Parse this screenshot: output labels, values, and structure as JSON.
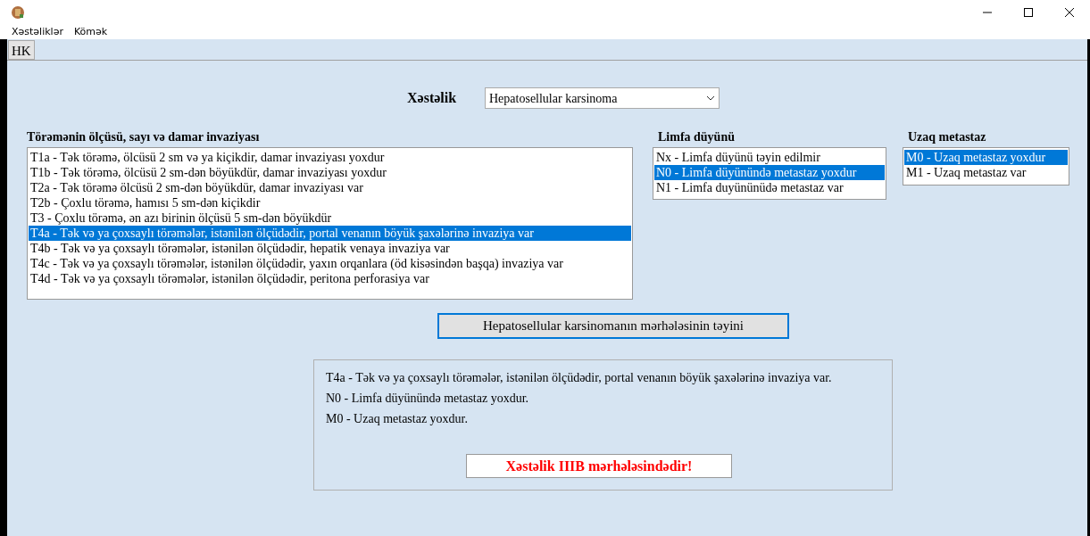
{
  "menu": [
    "Xəstəliklər",
    "Kömək"
  ],
  "tabs": [
    {
      "label": "HK",
      "selected": true
    }
  ],
  "disease": {
    "label": "Xəstəlik",
    "value": "Hepatosellular karsinoma"
  },
  "lists": [
    {
      "title": "Törəmənin ölçüsü, sayı və damar invaziyası",
      "items": [
        {
          "text": "T1a - Tək törəmə, ölcüsü 2 sm və ya  kiçikdir, damar invaziyası yoxdur",
          "selected": false
        },
        {
          "text": "T1b - Tək törəmə, ölcüsü 2 sm-dən böyükdür, damar invaziyası yoxdur",
          "selected": false
        },
        {
          "text": "T2a - Tək törəmə ölcüsü 2 sm-dən böyükdür, damar invaziyası var",
          "selected": false
        },
        {
          "text": "T2b - Çoxlu törəmə, hamısı 5 sm-dən kiçikdir",
          "selected": false
        },
        {
          "text": "T3 - Çoxlu törəmə, ən azı birinin ölçüsü 5 sm-dən böyükdür",
          "selected": false
        },
        {
          "text": "T4a - Tək və ya çoxsaylı törəmələr, istənilən ölçüdədir, portal venanın böyük şaxələrinə invaziya var",
          "selected": true
        },
        {
          "text": "T4b - Tək və ya çoxsaylı törəmələr, istənilən ölçüdədir, hepatik venaya invaziya var",
          "selected": false
        },
        {
          "text": "T4c - Tək və ya çoxsaylı törəmələr, istənilən ölçüdədir,  yaxın orqanlara (öd kisəsindən başqa) invaziya var",
          "selected": false
        },
        {
          "text": "T4d - Tək və ya çoxsaylı törəmələr, istənilən ölçüdədir, peritona perforasiya var",
          "selected": false
        }
      ]
    },
    {
      "title": "Limfa düyünü",
      "items": [
        {
          "text": "Nx - Limfa düyünü təyin edilmir",
          "selected": false
        },
        {
          "text": "N0 - Limfa düyünündə metastaz yoxdur",
          "selected": true
        },
        {
          "text": "N1 - Limfa duyününüdə metastaz var",
          "selected": false
        }
      ]
    },
    {
      "title": "Uzaq metastaz",
      "items": [
        {
          "text": "M0 - Uzaq metastaz yoxdur",
          "selected": true
        },
        {
          "text": "M1 - Uzaq metastaz var",
          "selected": false
        }
      ]
    }
  ],
  "button": "Hepatosellular karsinomanın mərhələsinin təyini",
  "result": {
    "lines": [
      "T4a - Tək və ya çoxsaylı törəmələr, istənilən ölçüdədir, portal venanın böyük şaxələrinə invaziya var.",
      "N0 - Limfa düyünündə metastaz yoxdur.",
      "M0 - Uzaq metastaz yoxdur."
    ],
    "stage": "Xəstəlik IIIB mərhələsindədir!"
  }
}
